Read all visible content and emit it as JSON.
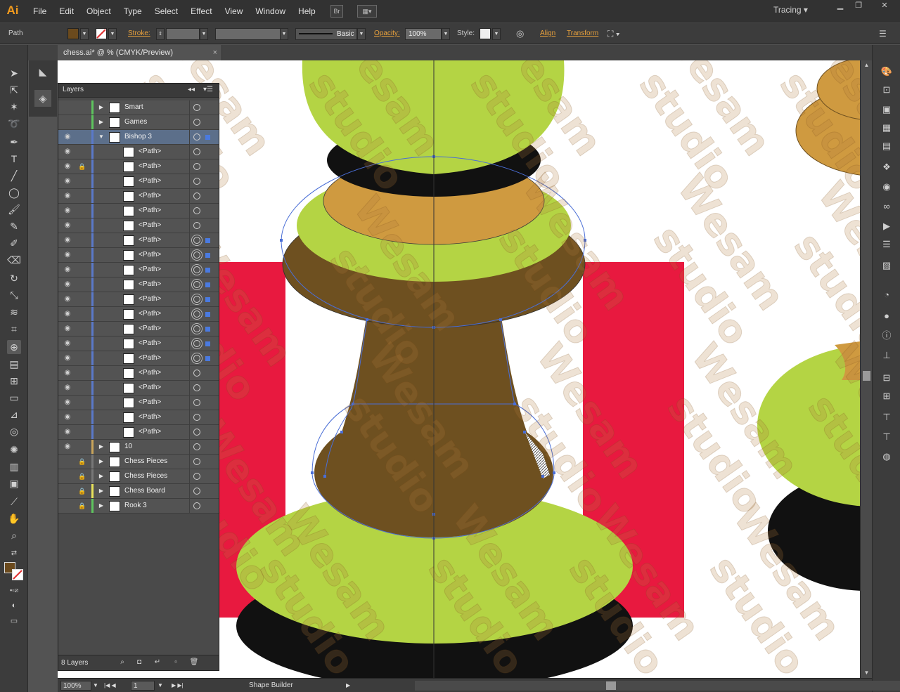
{
  "app": {
    "logo": "Ai",
    "workspace": "Tracing",
    "bridge_label": "Br"
  },
  "menu": [
    "File",
    "Edit",
    "Object",
    "Type",
    "Select",
    "Effect",
    "View",
    "Window",
    "Help"
  ],
  "control_bar": {
    "selection_type": "Path",
    "stroke_label": "Stroke:",
    "brush_label": "Basic",
    "opacity_label": "Opacity:",
    "opacity_value": "100%",
    "style_label": "Style:",
    "align_label": "Align",
    "transform_label": "Transform",
    "fill_color": "#6b4a1d"
  },
  "document_tab": {
    "title": "chess.ai* @ % (CMYK/Preview)",
    "close": "×"
  },
  "layers_panel": {
    "title": "Layers",
    "count_label": "8 Layers",
    "rows": [
      {
        "name": "Smart",
        "visible": false,
        "locked": false,
        "expand": "▶",
        "color": "#5ec45e",
        "kind": "layer"
      },
      {
        "name": "Games",
        "visible": false,
        "locked": false,
        "expand": "▶",
        "color": "#5ec45e",
        "kind": "layer"
      },
      {
        "name": "Bishop 3",
        "visible": true,
        "locked": false,
        "expand": "▼",
        "color": "#5a79c9",
        "kind": "layer"
      },
      {
        "name": "<Path>",
        "visible": true,
        "locked": false,
        "color": "#5a79c9",
        "kind": "sub"
      },
      {
        "name": "<Path>",
        "visible": true,
        "locked": true,
        "color": "#5a79c9",
        "kind": "sub"
      },
      {
        "name": "<Path>",
        "visible": true,
        "locked": false,
        "color": "#5a79c9",
        "kind": "sub"
      },
      {
        "name": "<Path>",
        "visible": true,
        "locked": false,
        "color": "#5a79c9",
        "kind": "sub"
      },
      {
        "name": "<Path>",
        "visible": true,
        "locked": false,
        "color": "#5a79c9",
        "kind": "sub"
      },
      {
        "name": "<Path>",
        "visible": true,
        "locked": false,
        "color": "#5a79c9",
        "kind": "sub"
      },
      {
        "name": "<Path>",
        "visible": true,
        "locked": false,
        "color": "#5a79c9",
        "kind": "sub"
      },
      {
        "name": "<Path>",
        "visible": true,
        "locked": false,
        "color": "#5a79c9",
        "kind": "sub"
      },
      {
        "name": "<Path>",
        "visible": true,
        "locked": false,
        "color": "#5a79c9",
        "kind": "sub"
      },
      {
        "name": "<Path>",
        "visible": true,
        "locked": false,
        "color": "#5a79c9",
        "kind": "sub"
      },
      {
        "name": "<Path>",
        "visible": true,
        "locked": false,
        "color": "#5a79c9",
        "kind": "sub"
      },
      {
        "name": "<Path>",
        "visible": true,
        "locked": false,
        "color": "#5a79c9",
        "kind": "sub"
      },
      {
        "name": "<Path>",
        "visible": true,
        "locked": false,
        "color": "#5a79c9",
        "kind": "sub"
      },
      {
        "name": "<Path>",
        "visible": true,
        "locked": false,
        "color": "#5a79c9",
        "kind": "sub"
      },
      {
        "name": "<Path>",
        "visible": true,
        "locked": false,
        "color": "#5a79c9",
        "kind": "sub"
      },
      {
        "name": "<Path>",
        "visible": true,
        "locked": false,
        "color": "#5a79c9",
        "kind": "sub"
      },
      {
        "name": "<Path>",
        "visible": true,
        "locked": false,
        "color": "#5a79c9",
        "kind": "sub"
      },
      {
        "name": "<Path>",
        "visible": true,
        "locked": false,
        "color": "#5a79c9",
        "kind": "sub"
      },
      {
        "name": "<Path>",
        "visible": true,
        "locked": false,
        "color": "#5a79c9",
        "kind": "sub"
      },
      {
        "name": "<Path>",
        "visible": true,
        "locked": false,
        "color": "#5a79c9",
        "kind": "sub"
      },
      {
        "name": "10",
        "visible": true,
        "locked": false,
        "expand": "▶",
        "color": "#c9a45a",
        "kind": "layer"
      },
      {
        "name": "Chess Pieces",
        "visible": false,
        "locked": true,
        "expand": "▶",
        "color": "#777777",
        "kind": "layer"
      },
      {
        "name": "Chess Pieces",
        "visible": false,
        "locked": true,
        "expand": "▶",
        "color": "#777777",
        "kind": "layer"
      },
      {
        "name": "Chess Board",
        "visible": false,
        "locked": true,
        "expand": "▶",
        "color": "#e8e25a",
        "kind": "layer"
      },
      {
        "name": "Rook 3",
        "visible": false,
        "locked": true,
        "expand": "▶",
        "color": "#5ec45e",
        "kind": "layer"
      }
    ]
  },
  "status_bar": {
    "zoom": "100%",
    "page": "1",
    "tool": "Shape Builder"
  },
  "watermark": {
    "line1": "Wesam",
    "line2": "studio"
  },
  "art_colors": {
    "green": "#b4d444",
    "brown": "#6e5020",
    "tan": "#cf9a40",
    "black": "#111111",
    "red": "#e8193f"
  }
}
